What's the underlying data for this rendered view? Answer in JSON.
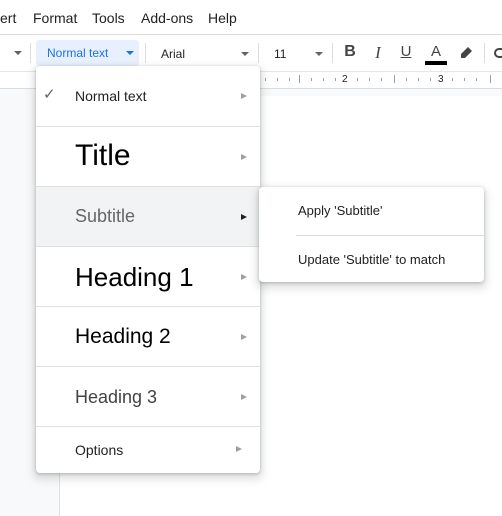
{
  "menubar": {
    "items": [
      "ert",
      "Format",
      "Tools",
      "Add-ons",
      "Help"
    ]
  },
  "toolbar": {
    "style_select": "Normal text",
    "font_select": "Arial",
    "font_size": "11",
    "bold_label": "B",
    "italic_label": "I",
    "underline_label": "U",
    "text_color_label": "A",
    "text_color": "#000000",
    "accent_color": "#1a73e8"
  },
  "ruler": {
    "labels": [
      "2",
      "3"
    ]
  },
  "style_menu": {
    "items": [
      {
        "label": "Normal text",
        "checked": true
      },
      {
        "label": "Title"
      },
      {
        "label": "Subtitle",
        "hovered": true
      },
      {
        "label": "Heading 1"
      },
      {
        "label": "Heading 2"
      },
      {
        "label": "Heading 3"
      },
      {
        "label": "Options"
      }
    ],
    "check_icon": "✓"
  },
  "submenu": {
    "items": [
      "Apply 'Subtitle'",
      "Update 'Subtitle' to match"
    ]
  }
}
